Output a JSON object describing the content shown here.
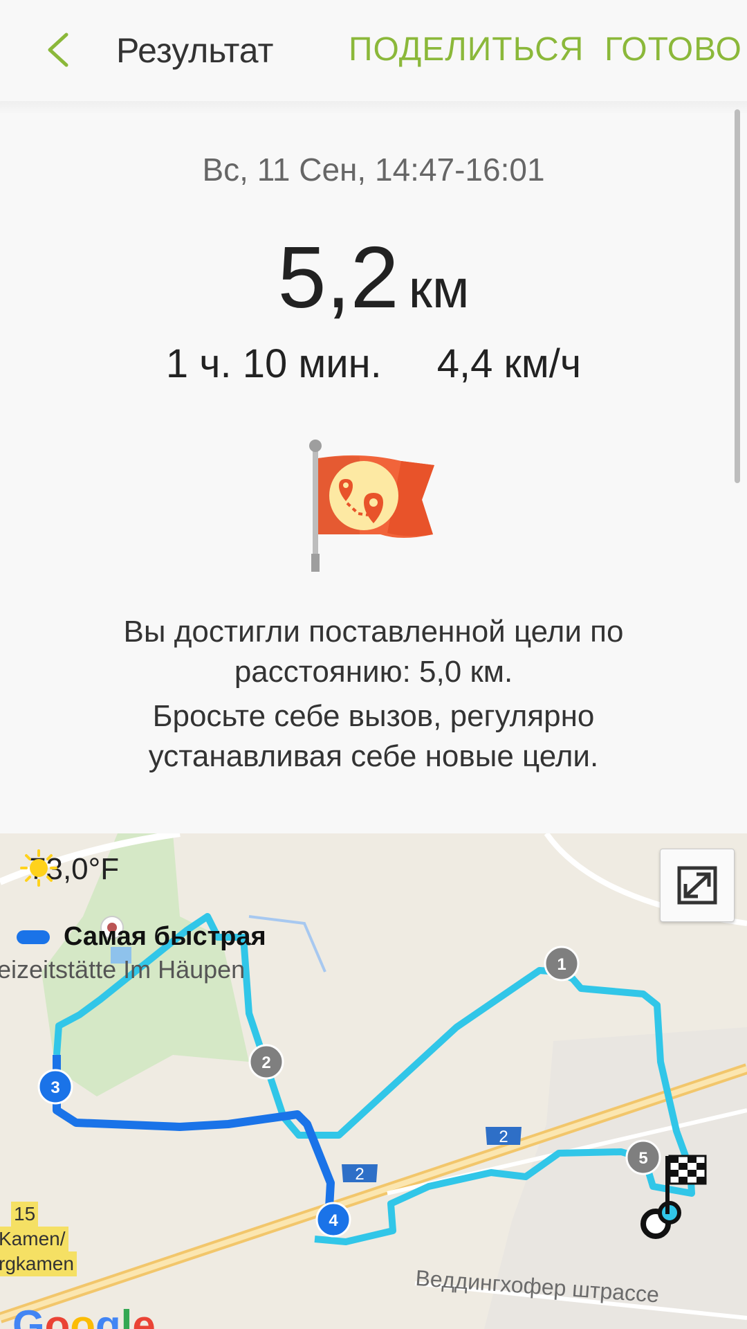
{
  "header": {
    "title": "Результат",
    "share_label": "ПОДЕЛИТЬСЯ",
    "done_label": "ГОТОВО"
  },
  "summary": {
    "date": "Вс, 11 Сен, 14:47-16:01",
    "distance_value": "5,2",
    "distance_unit": "км",
    "duration": "1 ч. 10 мин.",
    "speed": "4,4 км/ч"
  },
  "goal": {
    "line1": "Вы достигли поставленной цели по",
    "line2": "расстоянию: 5,0 км.",
    "line3": "Бросьте себе вызов, регулярно",
    "line4": "устанавливая себе новые цели."
  },
  "map": {
    "temperature": "73,0°F",
    "weather_icon": "sun-icon",
    "route_label": "Самая быстрая",
    "place_name": "eizeitstätte Im Häupen",
    "street_name": "Веддингхофер штрассе",
    "road_label_left_top": "15",
    "road_label_left_1": "Kamen/",
    "road_label_left_2": "rgkamen",
    "highway_marker": "2",
    "provider": "Google",
    "markers": [
      "1",
      "2",
      "3",
      "4",
      "5"
    ],
    "colors": {
      "route_light": "#31c6e8",
      "route_dark": "#1a73e8",
      "accent": "#8bb83a"
    }
  }
}
